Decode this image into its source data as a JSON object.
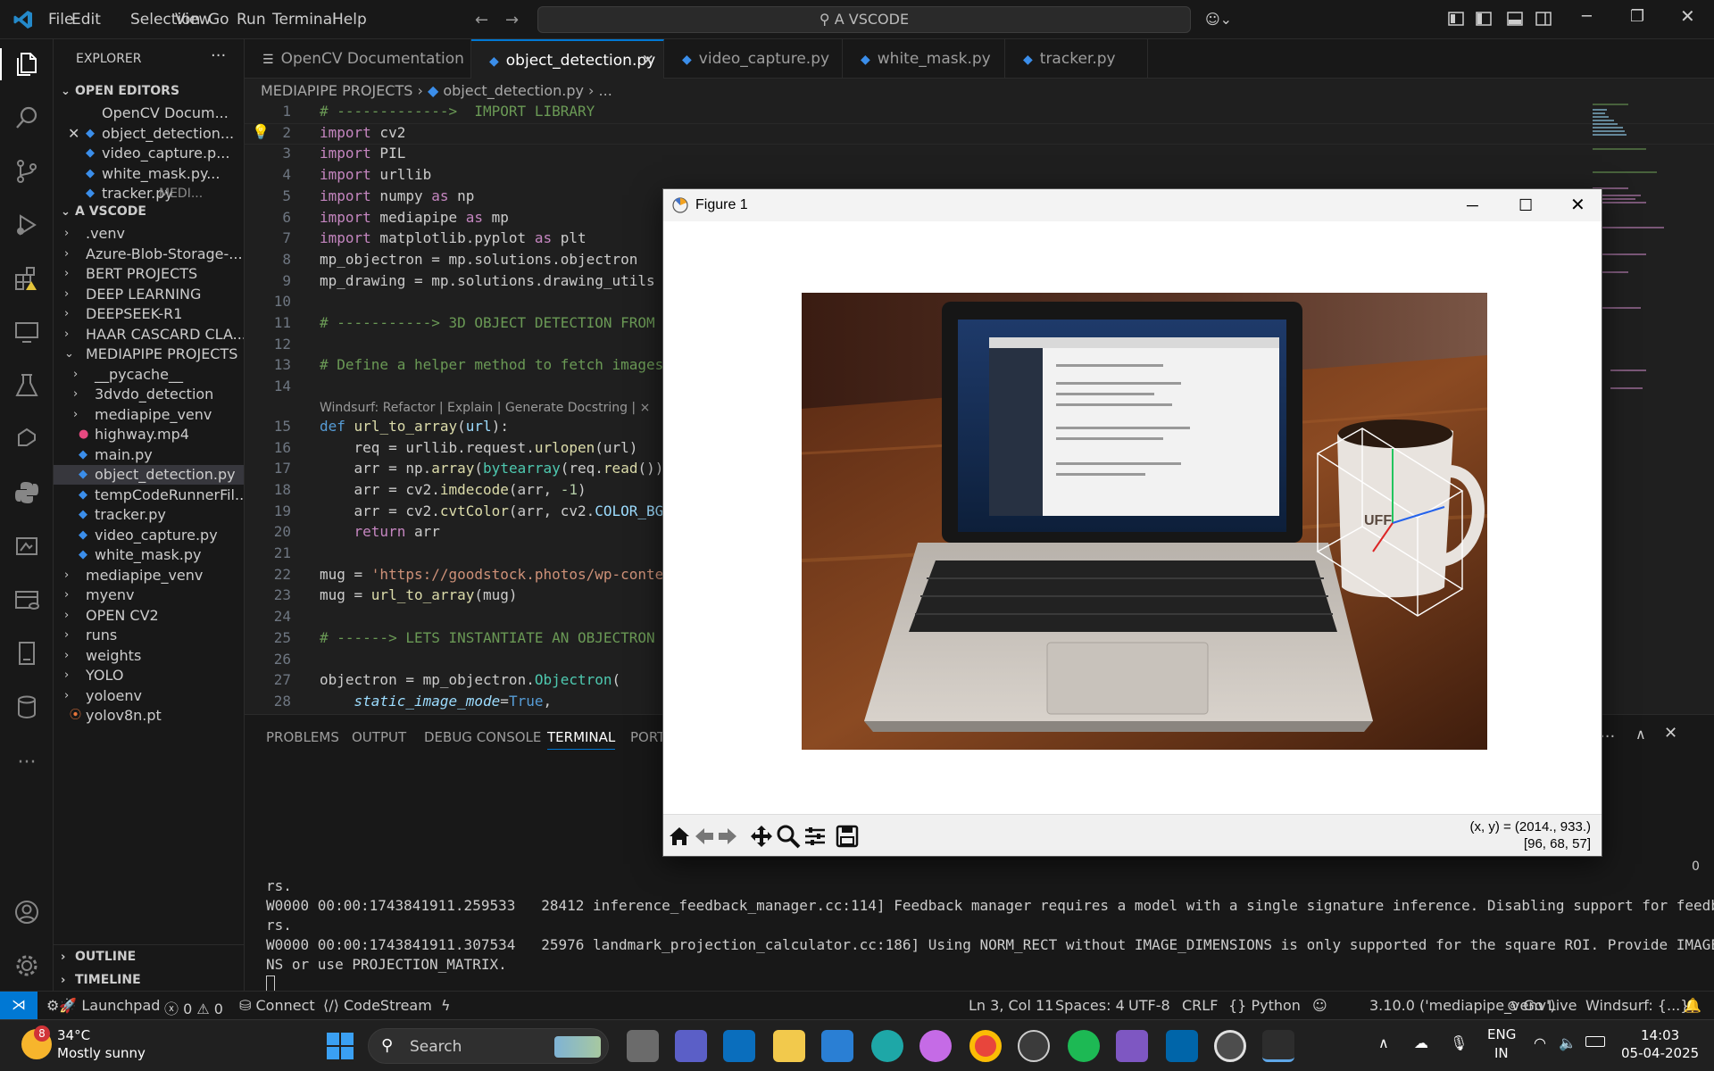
{
  "app": {
    "title": "A VSCODE",
    "menu": [
      "File",
      "Edit",
      "Selection",
      "View",
      "Go",
      "Run",
      "Terminal",
      "Help"
    ]
  },
  "sidebar": {
    "header": "EXPLORER",
    "open_editors_label": "OPEN EDITORS",
    "open_editors": [
      {
        "label": "OpenCV Docum...",
        "extra": ""
      },
      {
        "label": "object_detection...",
        "extra": ""
      },
      {
        "label": "video_capture.p...",
        "extra": ""
      },
      {
        "label": "white_mask.py...",
        "extra": ""
      },
      {
        "label": "tracker.py",
        "extra": "MEDI..."
      }
    ],
    "workspace_label": "A VSCODE",
    "tree": [
      {
        "label": ".venv",
        "indent": 1,
        "folder": true,
        "open": false
      },
      {
        "label": "Azure-Blob-Storage-...",
        "indent": 1,
        "folder": true,
        "open": false
      },
      {
        "label": "BERT PROJECTS",
        "indent": 1,
        "folder": true,
        "open": false
      },
      {
        "label": "DEEP LEARNING",
        "indent": 1,
        "folder": true,
        "open": false
      },
      {
        "label": "DEEPSEEK-R1",
        "indent": 1,
        "folder": true,
        "open": false
      },
      {
        "label": "HAAR CASCARD CLA...",
        "indent": 1,
        "folder": true,
        "open": false
      },
      {
        "label": "MEDIAPIPE PROJECTS",
        "indent": 1,
        "folder": true,
        "open": true
      },
      {
        "label": "__pycache__",
        "indent": 2,
        "folder": true,
        "open": false
      },
      {
        "label": "3dvdo_detection",
        "indent": 2,
        "folder": true,
        "open": false
      },
      {
        "label": "mediapipe_venv",
        "indent": 2,
        "folder": true,
        "open": false
      },
      {
        "label": "highway.mp4",
        "indent": 2,
        "folder": false,
        "icon": "video"
      },
      {
        "label": "main.py",
        "indent": 2,
        "folder": false,
        "icon": "py"
      },
      {
        "label": "object_detection.py",
        "indent": 2,
        "folder": false,
        "icon": "py",
        "selected": true
      },
      {
        "label": "tempCodeRunnerFil...",
        "indent": 2,
        "folder": false,
        "icon": "py"
      },
      {
        "label": "tracker.py",
        "indent": 2,
        "folder": false,
        "icon": "py"
      },
      {
        "label": "video_capture.py",
        "indent": 2,
        "folder": false,
        "icon": "py"
      },
      {
        "label": "white_mask.py",
        "indent": 2,
        "folder": false,
        "icon": "py"
      },
      {
        "label": "mediapipe_venv",
        "indent": 1,
        "folder": true,
        "open": false
      },
      {
        "label": "myenv",
        "indent": 1,
        "folder": true,
        "open": false
      },
      {
        "label": "OPEN CV2",
        "indent": 1,
        "folder": true,
        "open": false
      },
      {
        "label": "runs",
        "indent": 1,
        "folder": true,
        "open": false
      },
      {
        "label": "weights",
        "indent": 1,
        "folder": true,
        "open": false
      },
      {
        "label": "YOLO",
        "indent": 1,
        "folder": true,
        "open": false
      },
      {
        "label": "yoloenv",
        "indent": 1,
        "folder": true,
        "open": false
      },
      {
        "label": "yolov8n.pt",
        "indent": 1,
        "folder": false,
        "icon": "rss"
      }
    ],
    "outline_label": "OUTLINE",
    "timeline_label": "TIMELINE"
  },
  "tabs": [
    {
      "label": "OpenCV Documentation",
      "icon": "doc"
    },
    {
      "label": "object_detection.py",
      "icon": "py",
      "active": true
    },
    {
      "label": "video_capture.py",
      "icon": "py"
    },
    {
      "label": "white_mask.py",
      "icon": "py"
    },
    {
      "label": "tracker.py",
      "icon": "py"
    }
  ],
  "breadcrumb": {
    "folder": "MEDIAPIPE PROJECTS",
    "file": "object_detection.py",
    "rest": "..."
  },
  "codelens": "Windsurf: Refactor | Explain | Generate Docstring | ×",
  "code_lines": [
    {
      "n": "1",
      "html": "<span class='cm'># ------------->  IMPORT LIBRARY</span>"
    },
    {
      "n": "2",
      "html": "<span class='kw'>import</span> cv2"
    },
    {
      "n": "3",
      "html": "<span class='kw'>import</span> PIL"
    },
    {
      "n": "4",
      "html": "<span class='kw'>import</span> urllib"
    },
    {
      "n": "5",
      "html": "<span class='kw'>import</span> numpy <span class='kw'>as</span> np"
    },
    {
      "n": "6",
      "html": "<span class='kw'>import</span> mediapipe <span class='kw'>as</span> mp"
    },
    {
      "n": "7",
      "html": "<span class='kw'>import</span> matplotlib.pyplot <span class='kw'>as</span> plt"
    },
    {
      "n": "8",
      "html": "mp_objectron = mp.solutions.objectron"
    },
    {
      "n": "9",
      "html": "mp_drawing = mp.solutions.drawing_utils"
    },
    {
      "n": "10",
      "html": ""
    },
    {
      "n": "11",
      "html": "<span class='cm'># -----------> 3D OBJECT DETECTION FROM</span>"
    },
    {
      "n": "12",
      "html": ""
    },
    {
      "n": "13",
      "html": "<span class='cm'># Define a helper method to fetch images</span>"
    },
    {
      "n": "14",
      "html": ""
    },
    {
      "n": "15",
      "html": "<span class='bl'>def</span> <span class='fn'>url_to_array</span>(<span class='vr'>url</span>):"
    },
    {
      "n": "16",
      "html": "    req = urllib.request.<span class='fn'>urlopen</span>(url)"
    },
    {
      "n": "17",
      "html": "    arr = np.<span class='fn'>array</span>(<span class='cl'>bytearray</span>(req.<span class='fn'>read</span>())"
    },
    {
      "n": "18",
      "html": "    arr = cv2.<span class='fn'>imdecode</span>(arr, <span class='nm'>-1</span>)"
    },
    {
      "n": "19",
      "html": "    arr = cv2.<span class='fn'>cvtColor</span>(arr, cv2.<span class='vr'>COLOR_BG</span>"
    },
    {
      "n": "20",
      "html": "    <span class='kw'>return</span> arr"
    },
    {
      "n": "21",
      "html": ""
    },
    {
      "n": "22",
      "html": "mug = <span class='st'>'https://goodstock.photos/wp-conte</span>"
    },
    {
      "n": "23",
      "html": "mug = <span class='fn'>url_to_array</span>(mug)"
    },
    {
      "n": "24",
      "html": ""
    },
    {
      "n": "25",
      "html": "<span class='cm'># ------> LETS INSTANTIATE AN OBJECTRON</span>"
    },
    {
      "n": "26",
      "html": ""
    },
    {
      "n": "27",
      "html": "objectron = mp_objectron.<span class='cl'>Objectron</span>("
    },
    {
      "n": "28",
      "html": "    <span class='vr' style='font-style:italic'>static_image_mode</span>=<span class='bl'>True</span>,"
    }
  ],
  "panel": {
    "tabs": [
      "PROBLEMS",
      "OUTPUT",
      "DEBUG CONSOLE",
      "TERMINAL",
      "PORTS"
    ],
    "active": "TERMINAL",
    "lines": [
      "rs.",
      "W0000 00:00:1743841911.259533   28412 inference_feedback_manager.cc:114] Feedback manager requires a model with a single signature inference. Disabling support for feedback tenso",
      "rs.",
      "W0000 00:00:1743841911.307534   25976 landmark_projection_calculator.cc:186] Using NORM_RECT without IMAGE_DIMENSIONS is only supported for the square ROI. Provide IMAGE_DIMENSIO",
      "NS or use PROJECTION_MATRIX."
    ],
    "side_number": "0"
  },
  "status": {
    "launchpad": "Launchpad",
    "errors": "0",
    "warnings": "0",
    "connect": "Connect",
    "codestream": "CodeStream",
    "position": "Ln 3, Col 11",
    "spaces": "Spaces: 4",
    "encoding": "UTF-8",
    "eol": "CRLF",
    "language": "Python",
    "interpreter": "3.10.0 ('mediapipe_venv')",
    "golive": "Go Live",
    "windsurf": "Windsurf: {...}"
  },
  "figure": {
    "title": "Figure 1",
    "coords": "(x, y) = (2014., 933.)",
    "rgb": "[96, 68, 57]"
  },
  "taskbar": {
    "weather_temp": "34°C",
    "weather_desc": "Mostly sunny",
    "weather_badge": "8",
    "search": "Search",
    "lang1": "ENG",
    "lang2": "IN",
    "time": "14:03",
    "date": "05-04-2025"
  }
}
